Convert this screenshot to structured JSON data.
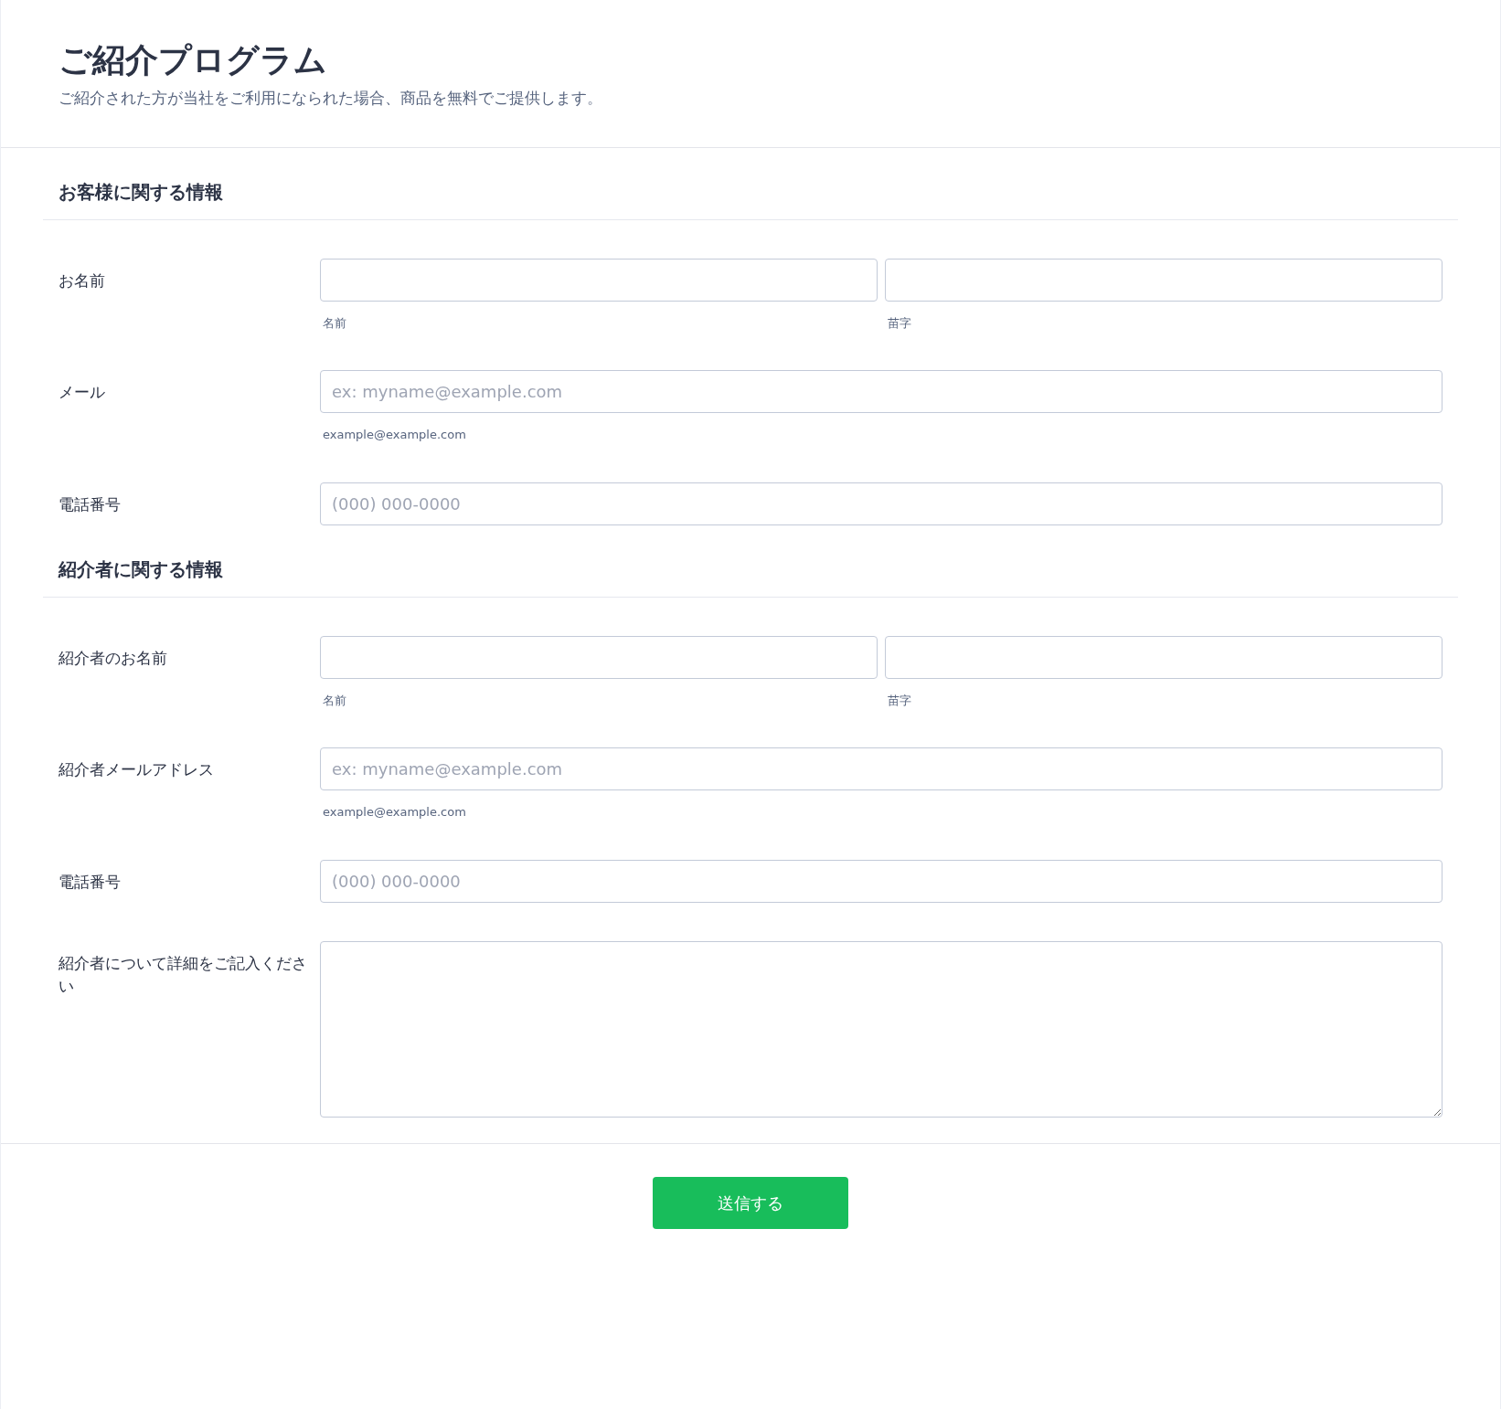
{
  "header": {
    "title": "ご紹介プログラム",
    "subtitle": "ご紹介された方が当社をご利用になられた場合、商品を無料でご提供します。"
  },
  "sections": [
    {
      "title": "お客様に関する情報",
      "fields": [
        {
          "kind": "name",
          "label": "お名前",
          "sublabels": [
            "名前",
            "苗字"
          ]
        },
        {
          "kind": "text",
          "label": "メール",
          "placeholder": "ex: myname@example.com",
          "hint": "example@example.com"
        },
        {
          "kind": "text",
          "label": "電話番号",
          "placeholder": "(000) 000-0000"
        }
      ]
    },
    {
      "title": "紹介者に関する情報",
      "fields": [
        {
          "kind": "name",
          "label": "紹介者のお名前",
          "sublabels": [
            "名前",
            "苗字"
          ]
        },
        {
          "kind": "text",
          "label": "紹介者メールアドレス",
          "placeholder": "ex: myname@example.com",
          "hint": "example@example.com"
        },
        {
          "kind": "text",
          "label": "電話番号",
          "placeholder": "(000) 000-0000"
        },
        {
          "kind": "textarea",
          "label": "紹介者について詳細をご記入ください"
        }
      ]
    }
  ],
  "submit": {
    "label": "送信する"
  }
}
